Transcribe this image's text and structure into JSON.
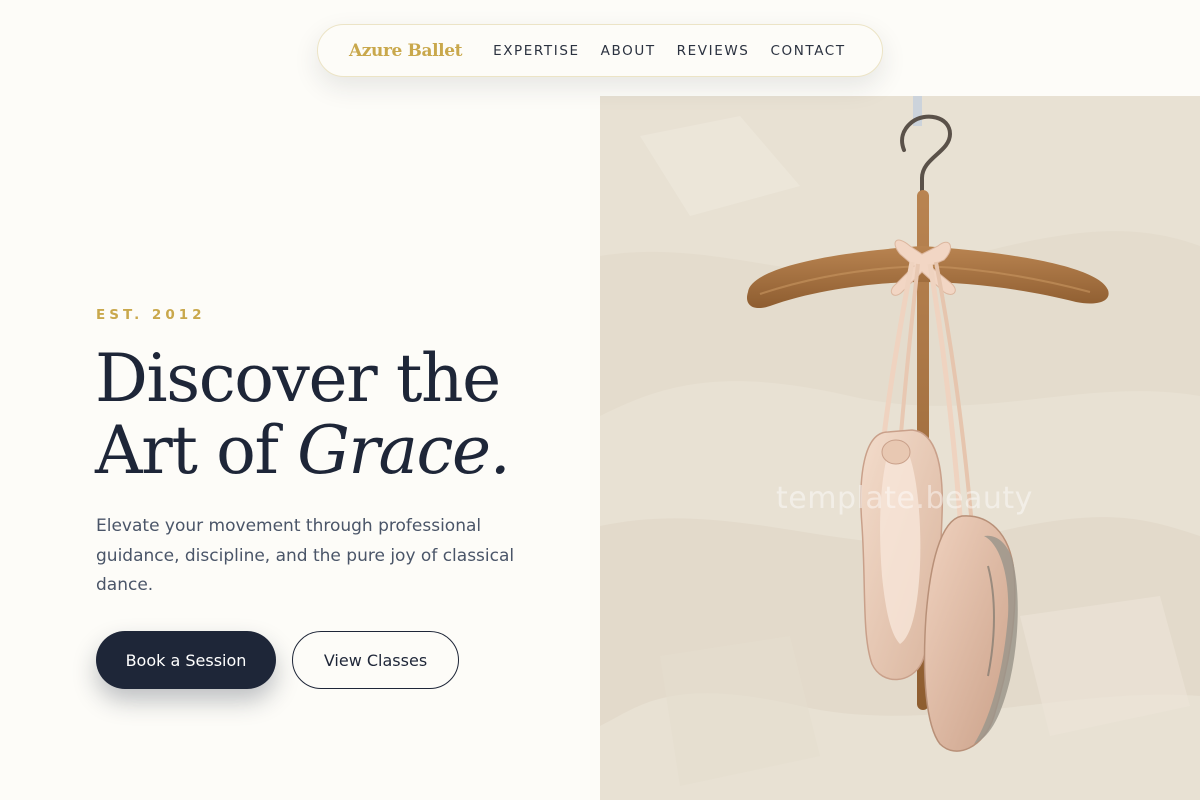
{
  "nav": {
    "brand": "Azure Ballet",
    "links": [
      {
        "label": "EXPERTISE"
      },
      {
        "label": "ABOUT"
      },
      {
        "label": "REVIEWS"
      },
      {
        "label": "CONTACT"
      }
    ]
  },
  "hero": {
    "eyebrow": "EST. 2012",
    "headline_line1": "Discover the",
    "headline_line2_prefix": "Art of ",
    "headline_line2_accent": "Grace.",
    "lead": "Elevate your movement through professional guidance, discipline, and the pure joy of classical dance.",
    "primary_cta": "Book a Session",
    "secondary_cta": "View Classes",
    "watermark": "template.beauty"
  },
  "colors": {
    "gold_accent": "#c9a84c",
    "navy": "#1e2638",
    "background": "#fdfcf8",
    "body_text": "#4a5568"
  },
  "icons": [
    "ballet-shoes-image"
  ]
}
